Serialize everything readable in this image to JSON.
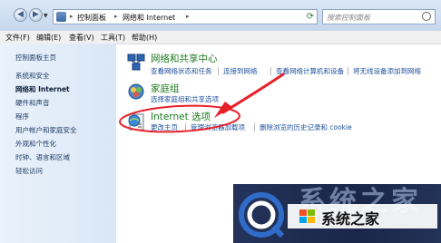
{
  "address_bar": {
    "crumbs": [
      "控制面板",
      "网络和 Internet"
    ],
    "search_placeholder": "搜索控制面板"
  },
  "menu": [
    "文件(F)",
    "编辑(E)",
    "查看(V)",
    "工具(T)",
    "帮助(H)"
  ],
  "sidebar": {
    "items": [
      "控制面板主页",
      "系统和安全",
      "网络和 Internet",
      "硬件和声音",
      "程序",
      "用户帐户和家庭安全",
      "外观和个性化",
      "时钟、语言和区域",
      "轻松访问"
    ],
    "current": "网络和 Internet"
  },
  "categories": [
    {
      "title": "网络和共享中心",
      "icon": "network-sharing-icon",
      "links": [
        "查看网络状态和任务",
        "连接到网络",
        "查看网络计算机和设备",
        "将无线设备添加到网络"
      ]
    },
    {
      "title": "家庭组",
      "icon": "homegroup-icon",
      "links": [
        "选择家庭组和共享选项"
      ]
    },
    {
      "title": "Internet 选项",
      "icon": "internet-options-icon",
      "links": [
        "更改主页",
        "管理浏览器加载项",
        "删除浏览的历史记录和 cookie"
      ]
    }
  ],
  "annotation": {
    "color": "#e8202a"
  },
  "watermark": {
    "text": "系统之家"
  }
}
